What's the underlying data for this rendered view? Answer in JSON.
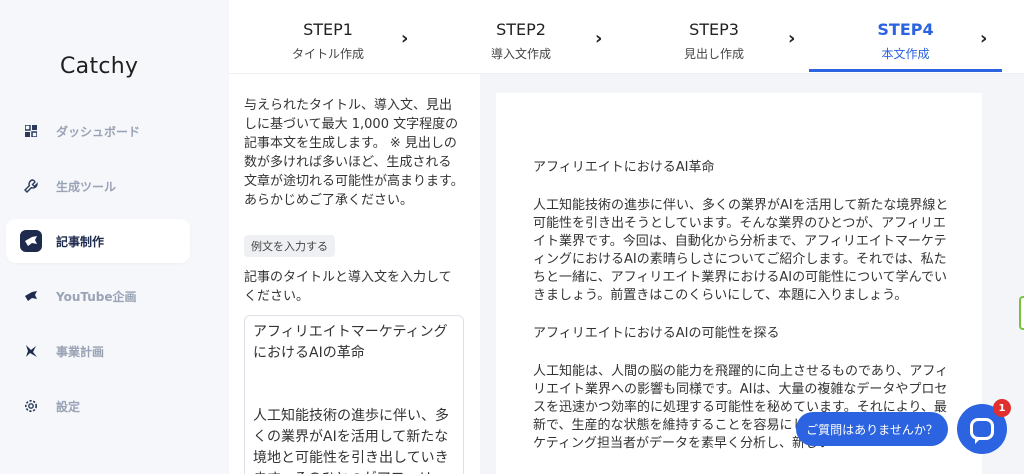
{
  "app": {
    "logo": "Catchy"
  },
  "sidebar": {
    "items": [
      {
        "label": "ダッシュボード",
        "icon": "dashboard-grid-icon"
      },
      {
        "label": "生成ツール",
        "icon": "wrench-icon"
      },
      {
        "label": "記事制作",
        "icon": "ninja-icon",
        "active": true
      },
      {
        "label": "YouTube企画",
        "icon": "ninja-icon"
      },
      {
        "label": "事業計画",
        "icon": "ninja-icon"
      },
      {
        "label": "設定",
        "icon": "gear-icon"
      }
    ]
  },
  "steps": [
    {
      "num": "STEP1",
      "label": "タイトル作成"
    },
    {
      "num": "STEP2",
      "label": "導入文作成"
    },
    {
      "num": "STEP3",
      "label": "見出し作成"
    },
    {
      "num": "STEP4",
      "label": "本文作成",
      "active": true
    }
  ],
  "instructions": {
    "text": "与えられたタイトル、導入文、見出しに基づいて最大 1,000 文字程度の記事本文を生成します。 ※ 見出しの数が多ければ多いほど、生成される文章が途切れる可能性が高まります。あらかじめご了承ください。",
    "example_button": "例文を入力する",
    "prompt": "記事のタイトルと導入文を入力してください。",
    "textarea_title": "アフィリエイトマーケティングにおけるAIの革命",
    "textarea_body": "人工知能技術の進歩に伴い、多くの業界がAIを活用して新たな境地と可能性を引き出していきます。そのひとつがアフィリ"
  },
  "output": {
    "heading1": "アフィリエイトにおけるAI革命",
    "paragraph1": "人工知能技術の進歩に伴い、多くの業界がAIを活用して新たな境界線と可能性を引き出そうとしています。そんな業界のひとつが、アフィリエイト業界です。今回は、自動化から分析まで、アフィリエイトマーケティングにおけるAIの素晴らしさについてご紹介します。それでは、私たちと一緒に、アフィリエイト業界におけるAIの可能性について学んでいきましょう。前置きはこのくらいにして、本題に入りましょう。",
    "heading2": "アフィリエイトにおけるAIの可能性を探る",
    "paragraph2": "人工知能は、人間の脳の能力を飛躍的に向上させるものであり、アフィリエイト業界への影響も同様です。AIは、大量の複雑なデータやプロセスを迅速かつ効率的に処理する可能性を秘めています。それにより、最新で、生産的な状態を維持することを容易にします。フィリエイトマーケティング担当者がデータを素早く分析し、新しい"
  },
  "chat": {
    "bubble": "ご質問はありませんか？",
    "badge": "1"
  }
}
